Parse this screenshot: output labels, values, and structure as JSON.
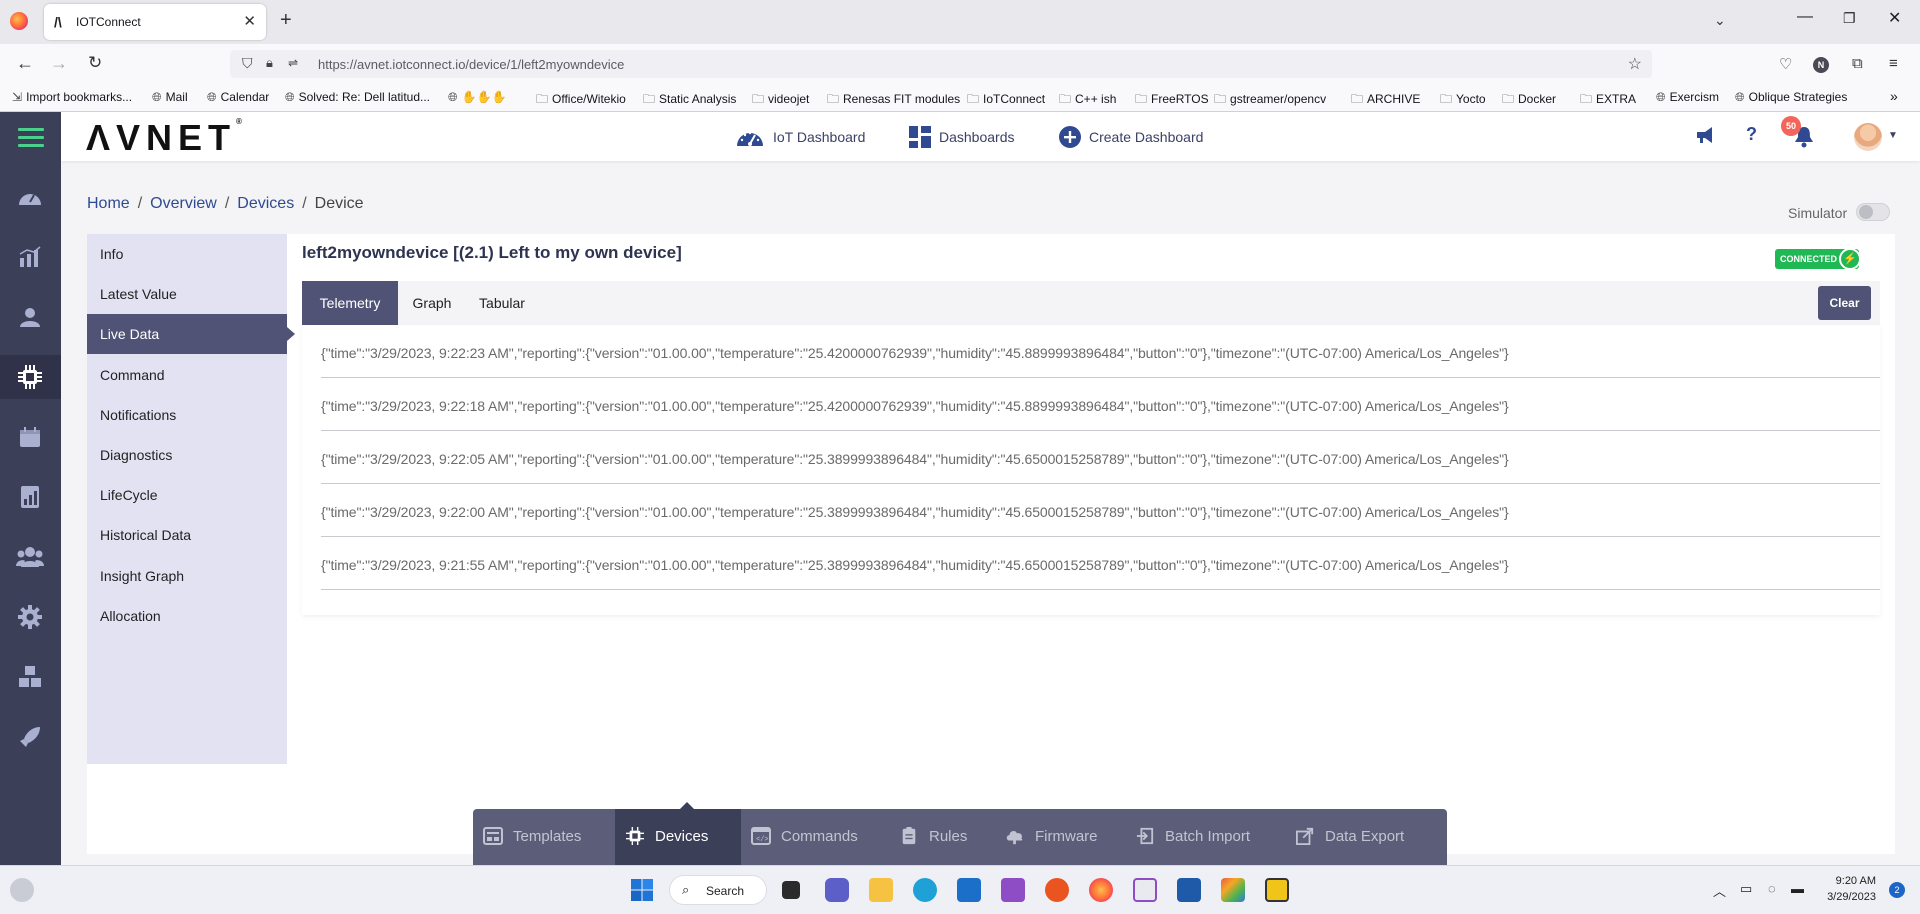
{
  "browser": {
    "tab_title": "IOTConnect",
    "url": "https://avnet.iotconnect.io/device/1/left2myowndevice",
    "bookmarks": [
      "Import bookmarks...",
      "Mail",
      "Calendar",
      "Solved: Re: Dell latitud...",
      "Office/Witekio",
      "Static Analysis",
      "videojet",
      "Renesas FIT modules",
      "IoTConnect",
      "C++ ish",
      "FreeRTOS",
      "gstreamer/opencv",
      "ARCHIVE",
      "Yocto",
      "Docker",
      "EXTRA",
      "Exercism",
      "Oblique Strategies"
    ],
    "profile_initial": "N"
  },
  "header": {
    "logo": "ΛVNET",
    "logo_mark": "®",
    "nav": [
      "IoT Dashboard",
      "Dashboards",
      "Create Dashboard"
    ],
    "notification_count": "50"
  },
  "breadcrumb": [
    "Home",
    "Overview",
    "Devices",
    "Device"
  ],
  "simulator_label": "Simulator",
  "device": {
    "title": "left2myowndevice [(2.1) Left to my own device]",
    "status": "CONNECTED"
  },
  "device_menu": [
    "Info",
    "Latest Value",
    "Live Data",
    "Command",
    "Notifications",
    "Diagnostics",
    "LifeCycle",
    "Historical Data",
    "Insight Graph",
    "Allocation"
  ],
  "tabs": [
    "Telemetry",
    "Graph",
    "Tabular"
  ],
  "clear_label": "Clear",
  "telemetry": [
    "{\"time\":\"3/29/2023, 9:22:23 AM\",\"reporting\":{\"version\":\"01.00.00\",\"temperature\":\"25.4200000762939\",\"humidity\":\"45.8899993896484\",\"button\":\"0\"},\"timezone\":\"(UTC-07:00) America/Los_Angeles\"}",
    "{\"time\":\"3/29/2023, 9:22:18 AM\",\"reporting\":{\"version\":\"01.00.00\",\"temperature\":\"25.4200000762939\",\"humidity\":\"45.8899993896484\",\"button\":\"0\"},\"timezone\":\"(UTC-07:00) America/Los_Angeles\"}",
    "{\"time\":\"3/29/2023, 9:22:05 AM\",\"reporting\":{\"version\":\"01.00.00\",\"temperature\":\"25.3899993896484\",\"humidity\":\"45.6500015258789\",\"button\":\"0\"},\"timezone\":\"(UTC-07:00) America/Los_Angeles\"}",
    "{\"time\":\"3/29/2023, 9:22:00 AM\",\"reporting\":{\"version\":\"01.00.00\",\"temperature\":\"25.3899993896484\",\"humidity\":\"45.6500015258789\",\"button\":\"0\"},\"timezone\":\"(UTC-07:00) America/Los_Angeles\"}",
    "{\"time\":\"3/29/2023, 9:21:55 AM\",\"reporting\":{\"version\":\"01.00.00\",\"temperature\":\"25.3899993896484\",\"humidity\":\"45.6500015258789\",\"button\":\"0\"},\"timezone\":\"(UTC-07:00) America/Los_Angeles\"}"
  ],
  "bottom_bar": [
    "Templates",
    "Devices",
    "Commands",
    "Rules",
    "Firmware",
    "Batch Import",
    "Data Export"
  ],
  "taskbar": {
    "search_label": "Search",
    "time": "9:20 AM",
    "date": "3/29/2023",
    "notif_count": "2"
  },
  "colors": {
    "sidebar": "#3b3f58",
    "accent": "#515376",
    "connected": "#1fb854",
    "hamburger": "#4bd08b",
    "menu_bg": "#e3e2f3"
  }
}
